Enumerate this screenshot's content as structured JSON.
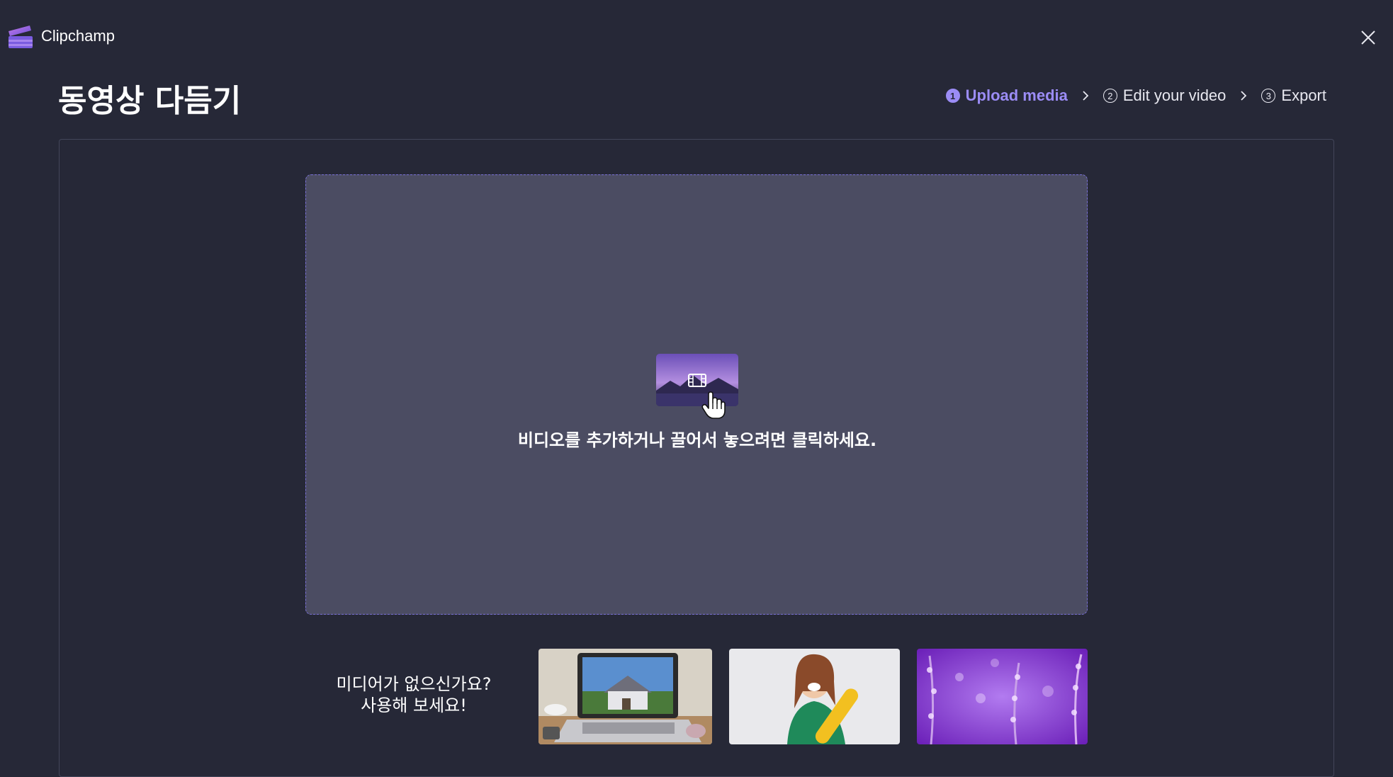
{
  "app": {
    "name": "Clipchamp"
  },
  "page": {
    "title": "동영상 다듬기"
  },
  "steps": [
    {
      "num": "1",
      "label": "Upload media",
      "active": true
    },
    {
      "num": "2",
      "label": "Edit your video",
      "active": false
    },
    {
      "num": "3",
      "label": "Export",
      "active": false
    }
  ],
  "dropzone": {
    "text": "비디오를 추가하거나 끌어서 놓으려면 클릭하세요."
  },
  "samples": {
    "prompt_line1": "미디어가 없으신가요?",
    "prompt_line2": "사용해 보세요!",
    "items": [
      "laptop-house",
      "woman-skateboard",
      "purple-flowers"
    ]
  },
  "colors": {
    "background": "#262837",
    "accent": "#9b8cf5",
    "dropzone": "#4b4c62"
  }
}
